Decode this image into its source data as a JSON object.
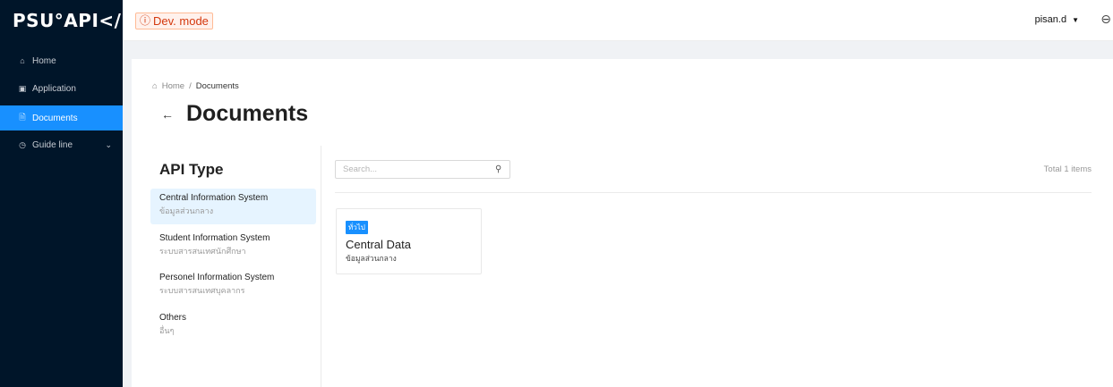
{
  "header": {
    "logo_text": "PSU°API</>",
    "dev_mode_icon": "ⓘ",
    "dev_mode_label": "Dev. mode",
    "username": "pisan.d",
    "caret": "▼",
    "logout_icon": "logout-icon"
  },
  "sidebar": {
    "items": [
      {
        "label": "Home",
        "icon": "home-icon"
      },
      {
        "label": "Application",
        "icon": "application-icon"
      },
      {
        "label": "Documents",
        "icon": "document-icon"
      },
      {
        "label": "Guide line",
        "icon": "clock-icon"
      }
    ],
    "active_color": "#1890ff",
    "background": "#001529"
  },
  "breadcrumb": {
    "home": "Home",
    "separator": "/",
    "current": "Documents"
  },
  "page": {
    "title": "Documents",
    "back_icon": "←"
  },
  "api_type": {
    "title": "API Type",
    "items": [
      {
        "name": "Central Information System",
        "sub": "ข้อมูลส่วนกลาง"
      },
      {
        "name": "Student Information System",
        "sub": "ระบบสารสนเทศนักศึกษา"
      },
      {
        "name": "Personel Information System",
        "sub": "ระบบสารสนเทศบุคลากร"
      },
      {
        "name": "Others",
        "sub": "อื่นๆ"
      }
    ]
  },
  "search": {
    "placeholder": "Search...",
    "value": ""
  },
  "total_items": "Total 1 items",
  "cards": [
    {
      "tag": "ทั่วไป",
      "title": "Central Data",
      "subtitle": "ข้อมูลส่วนกลาง"
    }
  ]
}
